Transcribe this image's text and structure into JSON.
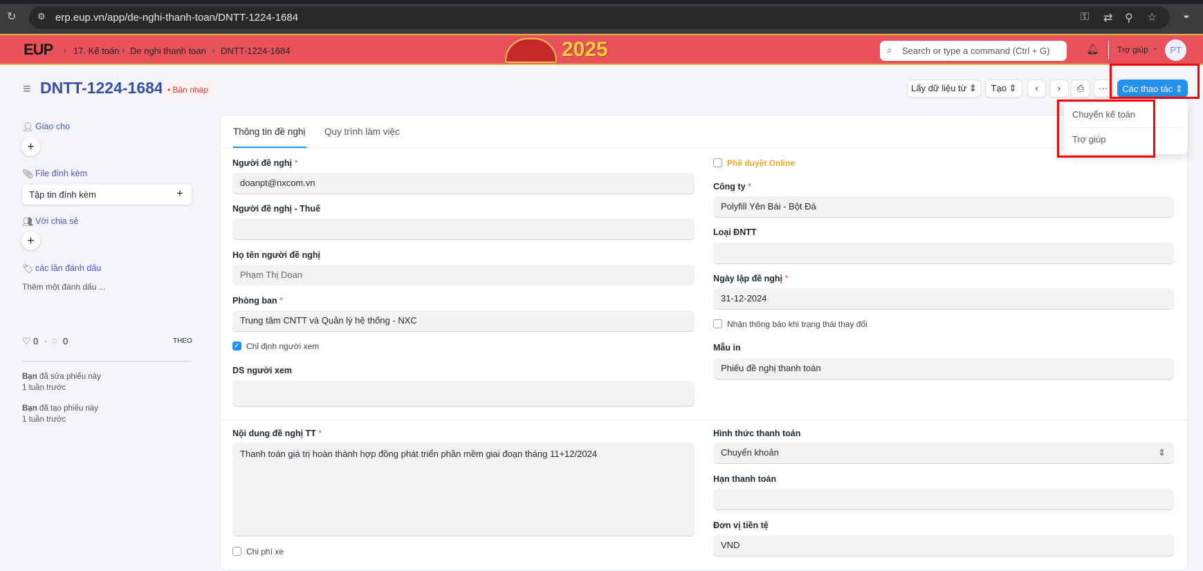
{
  "browser": {
    "url": "erp.eup.vn/app/de-nghi-thanh-toan/DNTT-1224-1684"
  },
  "navbar": {
    "logo": "EUP",
    "breadcrumbs": [
      "17. Kế toán",
      "De nghi thanh toan",
      "DNTT-1224-1684"
    ],
    "banner_text": "2025",
    "search_placeholder": "Search or type a command (Ctrl + G)",
    "help_label": "Trợ giúp",
    "avatar_initials": "PT"
  },
  "header": {
    "title": "DNTT-1224-1684",
    "status": "Bản nháp",
    "buttons": {
      "get_data": "Lấy dữ liệu từ",
      "create": "Tạo",
      "more": "···",
      "actions": "Các thao tác"
    }
  },
  "actions_menu": [
    "Chuyển kế toán",
    "Trợ giúp"
  ],
  "sidebar": {
    "assign": "Giao cho",
    "attachments": "File đính kèm",
    "attach_field": "Tập tin đính kèm",
    "shared": "Với chia sẻ",
    "tags": "các lần đánh dấu",
    "add_tag": "Thêm một đánh dấu ...",
    "likes": "0",
    "comments": "0",
    "follow": "THEO",
    "activity": [
      {
        "who": "Bạn",
        "what": " đã sửa phiếu này",
        "when": "1 tuần trước"
      },
      {
        "who": "Bạn",
        "what": " đã tạo phiếu này",
        "when": "1 tuần trước"
      }
    ]
  },
  "tabs": [
    "Thông tin đề nghị",
    "Quy trình làm việc"
  ],
  "form": {
    "requester": {
      "label": "Người đề nghị",
      "value": "doanpt@nxcom.vn"
    },
    "requester_tax": {
      "label": "Người đề nghị - Thuế",
      "value": ""
    },
    "requester_name": {
      "label": "Họ tên người đề nghị",
      "value": "Phạm Thị Doan"
    },
    "department": {
      "label": "Phòng ban",
      "value": "Trung tâm CNTT và Quản lý hệ thống - NXC"
    },
    "assign_viewer": {
      "label": "Chỉ định người xem",
      "checked": true
    },
    "viewers": {
      "label": "DS người xem",
      "value": ""
    },
    "online_approval": {
      "label": "Phê duyệt Online",
      "checked": false
    },
    "company": {
      "label": "Công ty",
      "value": "Polyfill Yên Bái - Bột Đá"
    },
    "type": {
      "label": "Loại ĐNTT",
      "value": ""
    },
    "date": {
      "label": "Ngày lập đề nghị",
      "value": "31-12-2024"
    },
    "notify": {
      "label": "Nhận thông báo khi trạng thái thay đổi",
      "checked": false
    },
    "print_format": {
      "label": "Mẫu in",
      "value": "Phiếu đề nghị thanh toán"
    },
    "content": {
      "label": "Nội dung đề nghị TT",
      "value": "Thanh toán giá trị hoàn thành hợp đồng phát triển phần mềm giai đoạn tháng 11+12/2024"
    },
    "vehicle_cost": {
      "label": "Chi phí xe",
      "checked": false
    },
    "payment_method": {
      "label": "Hình thức thanh toán",
      "value": "Chuyển khoản"
    },
    "due_date": {
      "label": "Hạn thanh toán",
      "value": ""
    },
    "currency": {
      "label": "Đơn vị tiền tệ",
      "value": "VND"
    }
  },
  "colors": {
    "nav": "#e9525a",
    "primary": "#2490ef",
    "title": "#3a4ea3",
    "highlight": "#ff0000"
  }
}
